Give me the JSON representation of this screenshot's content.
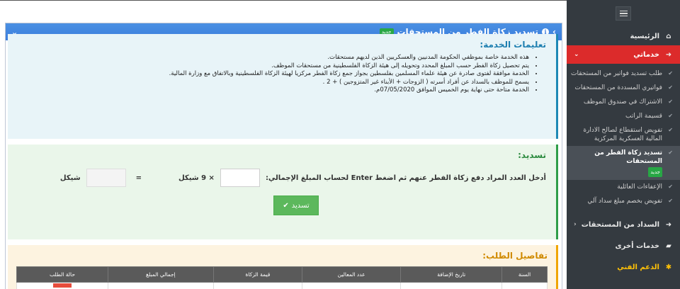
{
  "sidebar": {
    "home": "الرئيسية",
    "my_services": "خدماتي",
    "sub_items": [
      "طلب تسديد فواتير من المستحقات",
      "فواتيري المسددة من المستحقات",
      "الاشتراك في صندوق الموظف",
      "قسيمة الراتب",
      "تفويض استقطاع لصالح الادارة المالية العسكرية المركزية",
      "تسديد زكاة الفطر من المستحقات",
      "الإعفاءات العائلية",
      "تفويض بخصم مبلغ سداد آلي"
    ],
    "new_badge": "جديد",
    "payment_from_dues": "السداد من المستحقات",
    "other_services": "خدمات أخرى",
    "tech_support": "الدعم الفني"
  },
  "panel": {
    "title": "تسديد زكاة الفطر من المستحقات",
    "badge": "جديد"
  },
  "instructions": {
    "title": "تعليمات الخدمة:",
    "items": [
      "هذه الخدمة خاصة بموظفي الحكومة المدنيين والعسكريين الذين لديهم مستحقات.",
      "يتم تحصيل زكاة الفطر حسب المبلغ المحدد وتحويله إلى هيئة الزكاة الفلسطينية من مستحقات الموظف.",
      "الخدمة موافقة لفتوى صادرة عن هيئة علماء المسلمين بفلسطين بجواز جمع زكاة الفطر مركزيا لهيئة الزكاة الفلسطينية وبالاتفاق مع وزارة المالية.",
      "يسمح للموظف بالسداد عن أفراد أسرته ( الزوجات + الأبناء غير المتزوجين ) + 2 .",
      "الخدمة متاحة حتى نهاية يوم الخميس الموافق 07/05/2020م."
    ]
  },
  "payment": {
    "title": "تسديد:",
    "prompt": "أدخل العدد المراد دفع زكاة الفطر عنهم ثم اضغط Enter لحساب المبلغ الإجمالي:",
    "multiplier": "× 9 شيكل",
    "equals": "=",
    "currency": "شيكل",
    "button": "تسديد"
  },
  "details": {
    "title": "تفاصيل الطلب:",
    "columns": [
      "السنة",
      "تاريخ الإضافة",
      "عدد المعالين",
      "قيمة الزكاة",
      "إجمالي المبلغ",
      "حالة الطلب"
    ]
  },
  "colors": {
    "sidebar_bg": "#343a40",
    "active_red": "#dc2b2b",
    "header_blue": "#3b7ddd",
    "info_bg": "#e8f4f8",
    "success_bg": "#eaf6ea",
    "warning_bg": "#fdf3e0"
  }
}
